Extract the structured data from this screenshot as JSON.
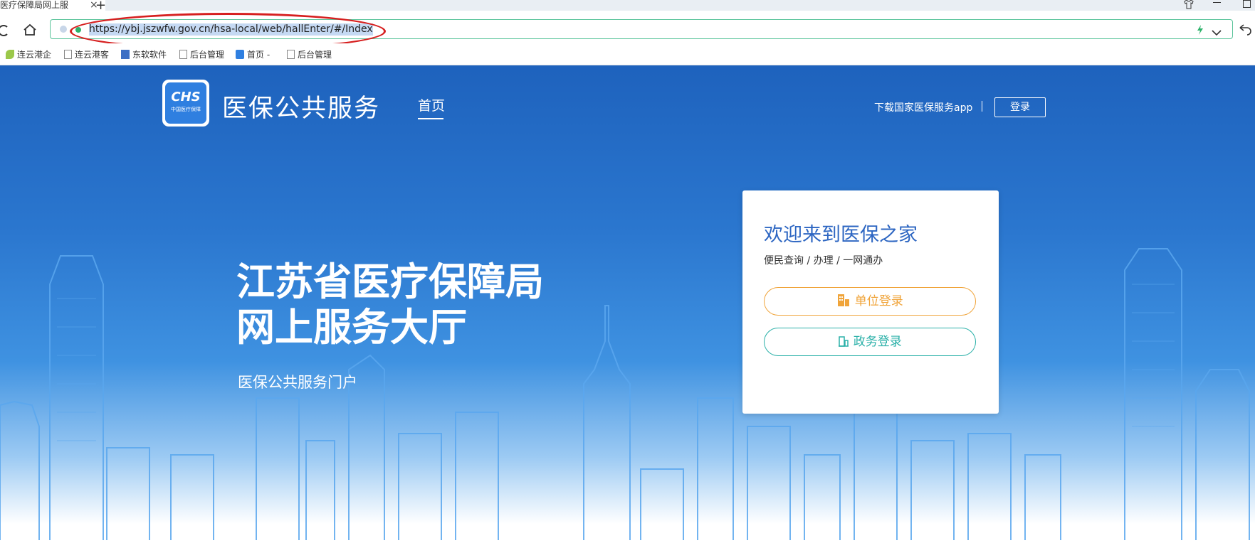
{
  "browser": {
    "tab_title": "医疗保障局网上服",
    "tab_close": "×",
    "new_tab": "+",
    "url": "https://ybj.jszwfw.gov.cn/hsa-local/web/hallEnter/#/Index"
  },
  "bookmarks": [
    "连云港企",
    "连云港客",
    "东软软件",
    "后台管理",
    "首页 -",
    "后台管理"
  ],
  "header": {
    "brand": "医保公共服务",
    "logo_text": "CHS",
    "logo_subtext": "中国医疗保障",
    "nav_home": "首页",
    "download_app": "下载国家医保服务app",
    "login": "登录"
  },
  "hero": {
    "title_line1": "江苏省医疗保障局",
    "title_line2": "网上服务大厅",
    "subtitle": "医保公共服务门户"
  },
  "card": {
    "title": "欢迎来到医保之家",
    "subtitle": "便民查询 / 办理 / 一网通办",
    "unit_login": "单位登录",
    "gov_login": "政务登录"
  },
  "colors": {
    "primary_blue": "#1e62bd",
    "card_title": "#2d66c2",
    "unit_orange": "#f0a43a",
    "gov_teal": "#2ab0a8",
    "annotation_red": "#d61f1f"
  }
}
